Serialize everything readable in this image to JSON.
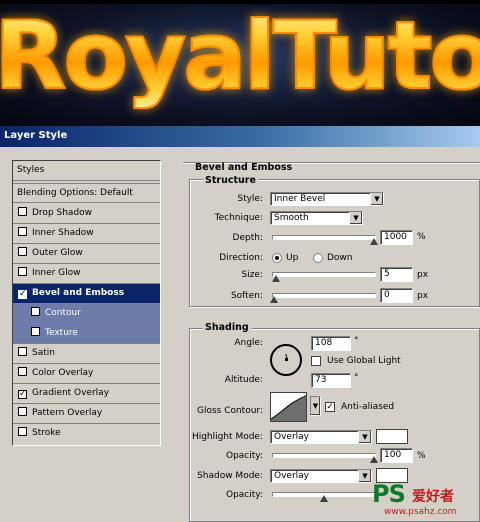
{
  "banner": {
    "logo_text": "RoyalTuto"
  },
  "window": {
    "title": "Layer Style"
  },
  "styles_list": {
    "header": "Styles",
    "blending": "Blending Options: Default",
    "items": [
      {
        "label": "Drop Shadow",
        "checked": false
      },
      {
        "label": "Inner Shadow",
        "checked": false
      },
      {
        "label": "Outer Glow",
        "checked": false
      },
      {
        "label": "Inner Glow",
        "checked": false
      },
      {
        "label": "Bevel and Emboss",
        "checked": true,
        "selected": true
      },
      {
        "label": "Contour",
        "checked": false,
        "sub": true
      },
      {
        "label": "Texture",
        "checked": false,
        "sub": true
      },
      {
        "label": "Satin",
        "checked": false
      },
      {
        "label": "Color Overlay",
        "checked": false
      },
      {
        "label": "Gradient Overlay",
        "checked": true
      },
      {
        "label": "Pattern Overlay",
        "checked": false
      },
      {
        "label": "Stroke",
        "checked": false
      }
    ]
  },
  "bevel": {
    "section_title": "Bevel and Emboss",
    "structure": {
      "title": "Structure",
      "style_label": "Style:",
      "style_value": "Inner Bevel",
      "technique_label": "Technique:",
      "technique_value": "Smooth",
      "depth_label": "Depth:",
      "depth_value": "1000",
      "depth_unit": "%",
      "depth_level": 1.0,
      "direction_label": "Direction:",
      "direction_up": "Up",
      "direction_down": "Down",
      "direction_selected": "Up",
      "size_label": "Size:",
      "size_value": "5",
      "size_unit": "px",
      "size_level": 0.02,
      "soften_label": "Soften:",
      "soften_value": "0",
      "soften_unit": "px",
      "soften_level": 0.0
    },
    "shading": {
      "title": "Shading",
      "angle_label": "Angle:",
      "angle_value": "108",
      "angle_unit": "°",
      "global_light_label": "Use Global Light",
      "global_light_checked": false,
      "altitude_label": "Altitude:",
      "altitude_value": "73",
      "altitude_unit": "°",
      "gloss_label": "Gloss Contour:",
      "anti_aliased_label": "Anti-aliased",
      "anti_aliased_checked": true,
      "highlight_mode_label": "Highlight Mode:",
      "highlight_mode_value": "Overlay",
      "highlight_color": "#ffffff",
      "highlight_opacity_label": "Opacity:",
      "highlight_opacity_value": "100",
      "highlight_opacity_unit": "%",
      "highlight_opacity_level": 1.0,
      "shadow_mode_label": "Shadow Mode:",
      "shadow_mode_value": "Overlay",
      "shadow_color": "#ffffff",
      "shadow_opacity_label": "Opacity:",
      "shadow_opacity_level": 0.5
    }
  },
  "watermark": {
    "ps": "PS",
    "cn": "爱好者",
    "url": "www.psahz.com"
  }
}
